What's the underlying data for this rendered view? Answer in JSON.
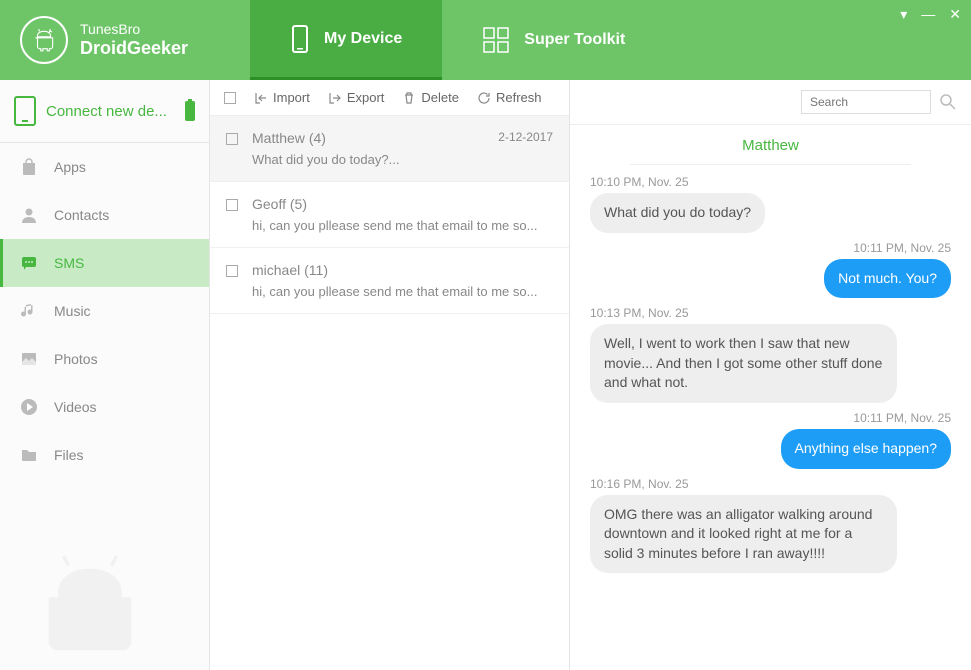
{
  "brand": {
    "name": "TunesBro",
    "product": "DroidGeeker"
  },
  "nav": {
    "my_device": "My Device",
    "super_toolkit": "Super Toolkit"
  },
  "connect": {
    "label": "Connect new de..."
  },
  "sidebar": {
    "items": [
      {
        "label": "Apps"
      },
      {
        "label": "Contacts"
      },
      {
        "label": "SMS"
      },
      {
        "label": "Music"
      },
      {
        "label": "Photos"
      },
      {
        "label": "Videos"
      },
      {
        "label": "Files"
      }
    ]
  },
  "toolbar": {
    "import": "Import",
    "export": "Export",
    "delete": "Delete",
    "refresh": "Refresh"
  },
  "search": {
    "placeholder": "Search"
  },
  "conversations": [
    {
      "name": "Matthew",
      "count": "(4)",
      "preview": "What did you do today?...",
      "date": "2-12-2017"
    },
    {
      "name": "Geoff",
      "count": "(5)",
      "preview": "hi, can you pllease send me that email to me so...",
      "date": ""
    },
    {
      "name": "michael",
      "count": "(11)",
      "preview": "hi, can you pllease send me that email to me so...",
      "date": ""
    }
  ],
  "chat": {
    "title": "Matthew",
    "messages": [
      {
        "time": "10:10 PM, Nov. 25",
        "dir": "in",
        "text": "What did you do today?"
      },
      {
        "time": "10:11 PM, Nov. 25",
        "dir": "out",
        "text": "Not much. You?"
      },
      {
        "time": "10:13 PM, Nov. 25",
        "dir": "in",
        "text": " Well, I went to work then I saw that new movie... And then I got some other stuff done and  what not."
      },
      {
        "time": "10:11 PM, Nov. 25",
        "dir": "out",
        "text": "Anything else happen?"
      },
      {
        "time": "10:16 PM, Nov. 25",
        "dir": "in",
        "text": "  OMG there was an alligator walking around downtown and it looked right at me for a solid 3 minutes before I ran away!!!!"
      }
    ]
  }
}
